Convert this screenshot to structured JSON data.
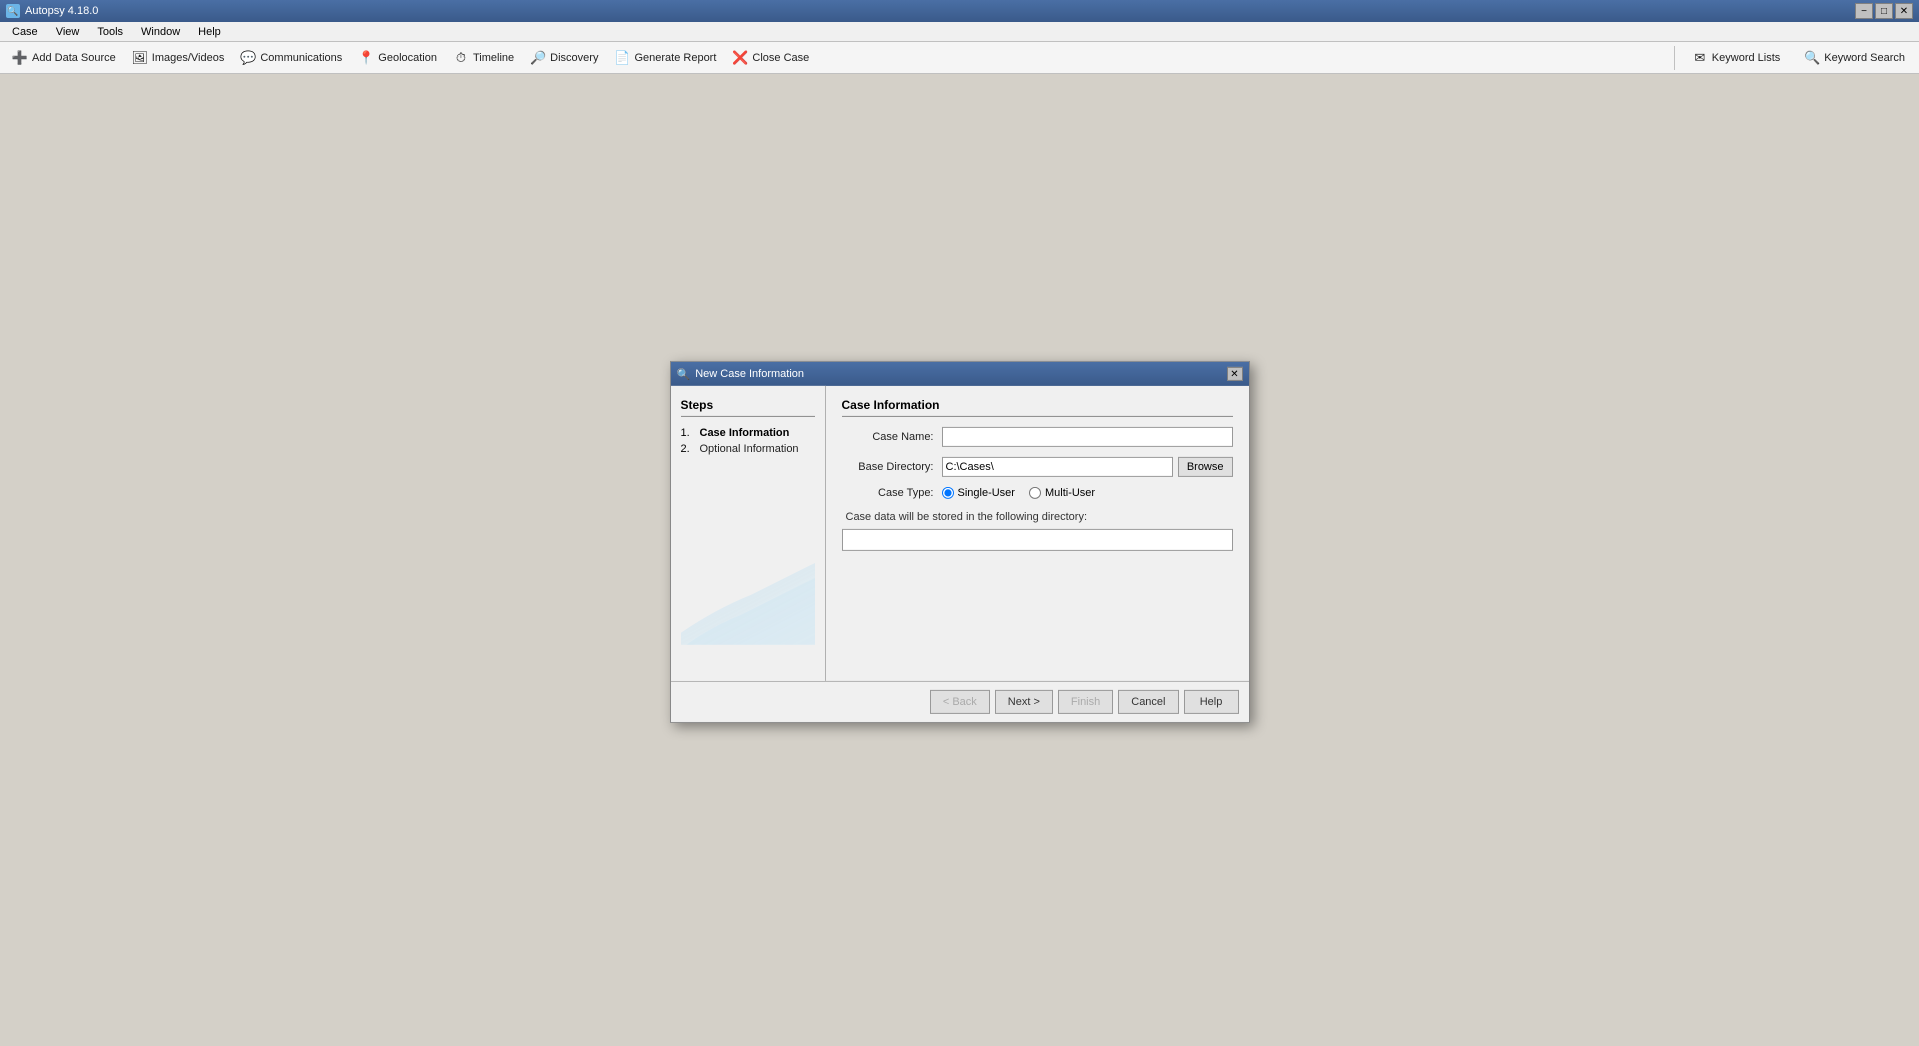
{
  "app": {
    "title": "Autopsy 4.18.0",
    "icon": "🔍"
  },
  "titlebar": {
    "minimize_label": "−",
    "maximize_label": "□",
    "close_label": "✕"
  },
  "menubar": {
    "items": [
      "Case",
      "View",
      "Tools",
      "Window",
      "Help"
    ]
  },
  "toolbar": {
    "buttons": [
      {
        "id": "add-data-source",
        "icon": "➕",
        "label": "Add Data Source"
      },
      {
        "id": "images-videos",
        "icon": "🖼",
        "label": "Images/Videos"
      },
      {
        "id": "communications",
        "icon": "💬",
        "label": "Communications"
      },
      {
        "id": "geolocation",
        "icon": "📍",
        "label": "Geolocation"
      },
      {
        "id": "timeline",
        "icon": "⏱",
        "label": "Timeline"
      },
      {
        "id": "discovery",
        "icon": "🔎",
        "label": "Discovery"
      },
      {
        "id": "generate-report",
        "icon": "📄",
        "label": "Generate Report"
      },
      {
        "id": "close-case",
        "icon": "❌",
        "label": "Close Case"
      }
    ],
    "right_buttons": [
      {
        "id": "keyword-lists",
        "icon": "✉",
        "label": "Keyword Lists"
      },
      {
        "id": "keyword-search",
        "icon": "🔍",
        "label": "Keyword Search"
      }
    ]
  },
  "dialog": {
    "title": "New Case Information",
    "icon": "🔍",
    "steps_heading": "Steps",
    "case_info_heading": "Case Information",
    "steps": [
      {
        "number": "1.",
        "label": "Case Information",
        "active": true
      },
      {
        "number": "2.",
        "label": "Optional Information",
        "active": false
      }
    ],
    "form": {
      "case_name_label": "Case Name:",
      "case_name_value": "",
      "base_directory_label": "Base Directory:",
      "base_directory_value": "C:\\Cases\\",
      "browse_label": "Browse",
      "case_type_label": "Case Type:",
      "single_user_label": "Single-User",
      "multi_user_label": "Multi-User",
      "storage_notice": "Case data will be stored in the following directory:",
      "storage_path": ""
    },
    "buttons": {
      "back": "< Back",
      "next": "Next >",
      "finish": "Finish",
      "cancel": "Cancel",
      "help": "Help"
    }
  }
}
